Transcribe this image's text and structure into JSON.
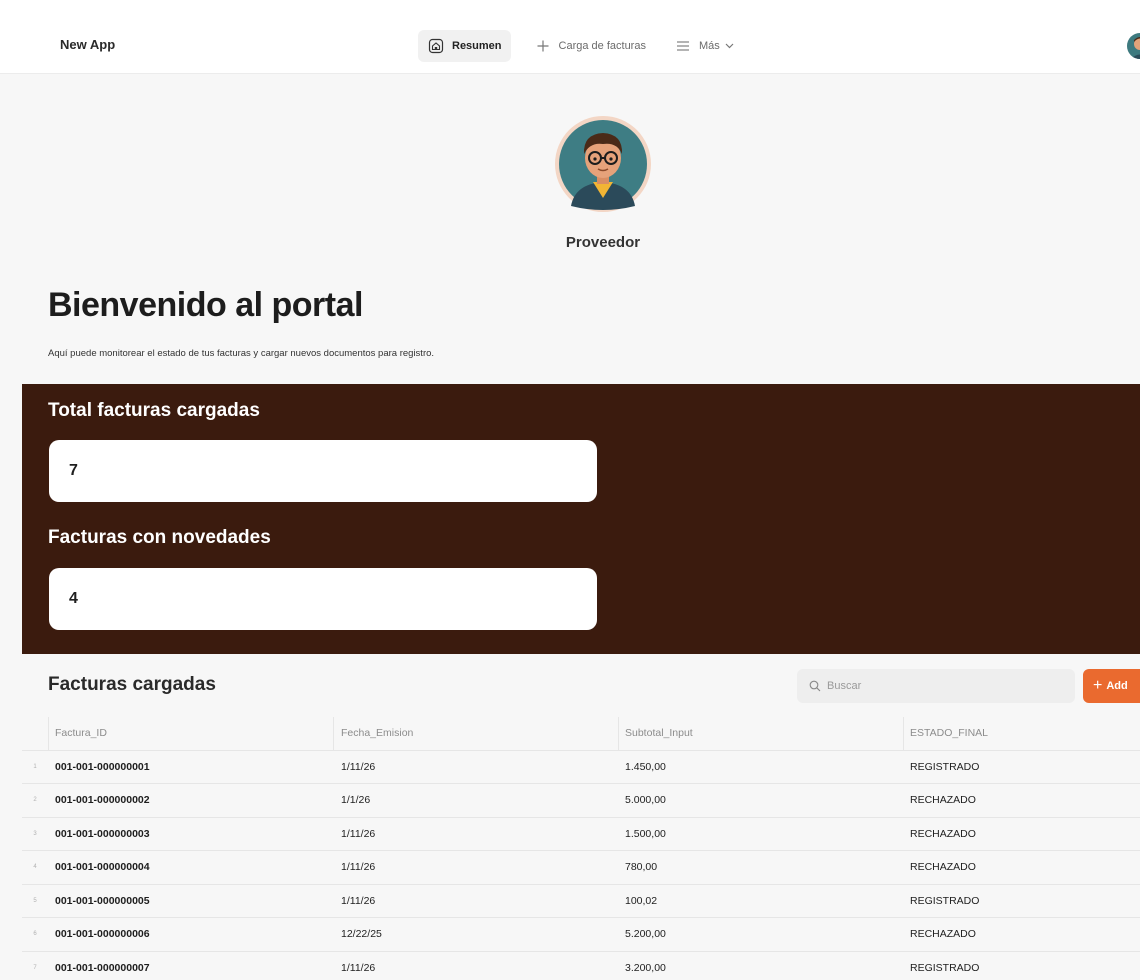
{
  "app": {
    "name": "New App"
  },
  "nav": {
    "resumen": "Resumen",
    "carga": "Carga de facturas",
    "mas": "Más"
  },
  "profile": {
    "name": "Proveedor"
  },
  "welcome": {
    "title": "Bienvenido al portal",
    "subtitle": "Aquí puede monitorear el estado de tus facturas y cargar nuevos documentos para registro."
  },
  "stats": {
    "total_label": "Total facturas cargadas",
    "total_value": "7",
    "novedades_label": "Facturas con novedades",
    "novedades_value": "4"
  },
  "table": {
    "title": "Facturas cargadas",
    "search_placeholder": "Buscar",
    "add_label": "Add",
    "columns": [
      "Factura_ID",
      "Fecha_Emision",
      "Subtotal_Input",
      "ESTADO_FINAL"
    ],
    "rows": [
      {
        "n": "1",
        "id": "001-001-000000001",
        "fecha": "1/11/26",
        "subtotal": "1.450,00",
        "estado": "REGISTRADO"
      },
      {
        "n": "2",
        "id": "001-001-000000002",
        "fecha": "1/1/26",
        "subtotal": "5.000,00",
        "estado": "RECHAZADO"
      },
      {
        "n": "3",
        "id": "001-001-000000003",
        "fecha": "1/11/26",
        "subtotal": "1.500,00",
        "estado": "RECHAZADO"
      },
      {
        "n": "4",
        "id": "001-001-000000004",
        "fecha": "1/11/26",
        "subtotal": "780,00",
        "estado": "RECHAZADO"
      },
      {
        "n": "5",
        "id": "001-001-000000005",
        "fecha": "1/11/26",
        "subtotal": "100,02",
        "estado": "REGISTRADO"
      },
      {
        "n": "6",
        "id": "001-001-000000006",
        "fecha": "12/22/25",
        "subtotal": "5.200,00",
        "estado": "RECHAZADO"
      },
      {
        "n": "7",
        "id": "001-001-000000007",
        "fecha": "1/11/26",
        "subtotal": "3.200,00",
        "estado": "REGISTRADO"
      }
    ]
  },
  "colors": {
    "accent": "#ea6a2f",
    "panel": "#3b1b0e"
  },
  "icons": [
    "home-icon",
    "plus-icon",
    "menu-icon",
    "chevron-down-icon",
    "search-icon",
    "avatar"
  ]
}
